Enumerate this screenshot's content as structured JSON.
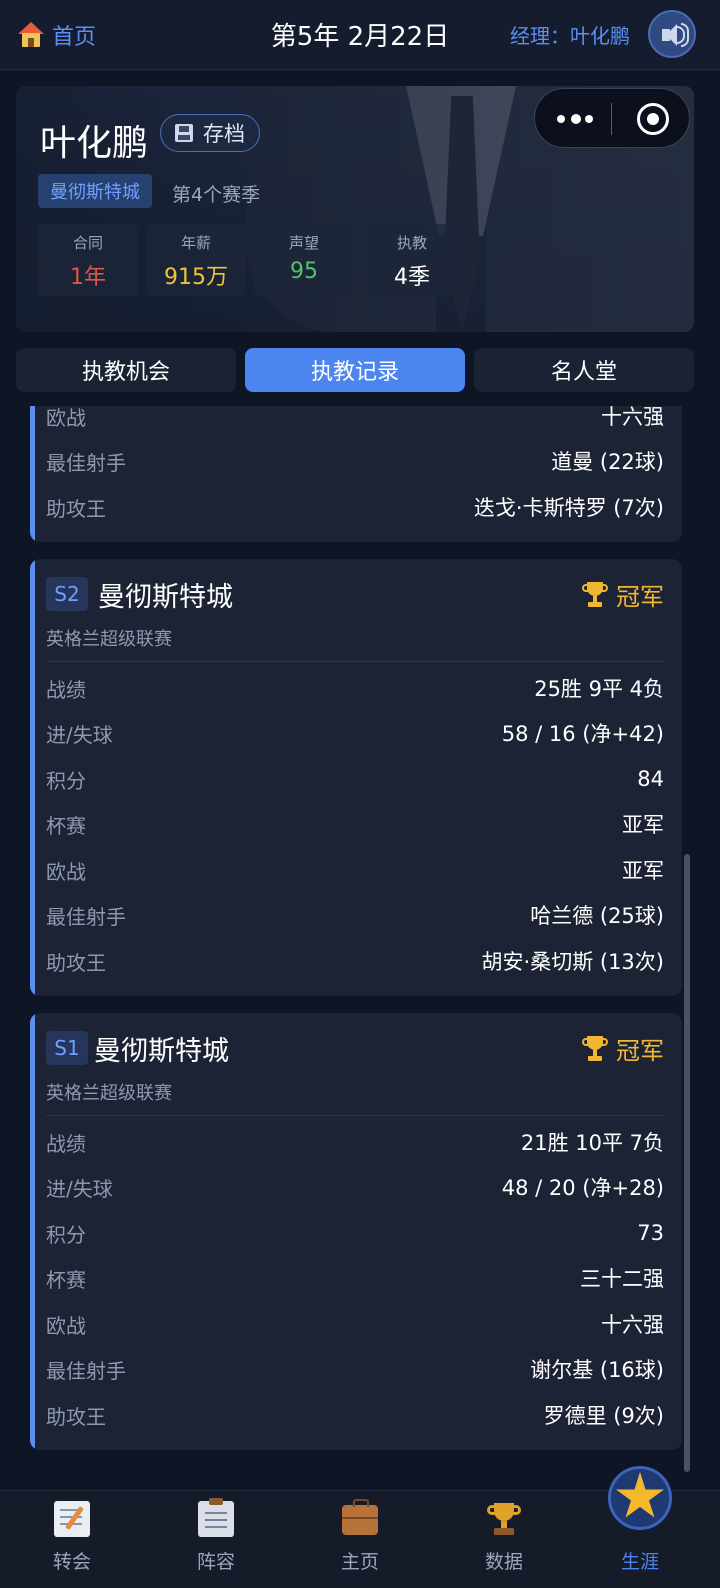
{
  "topbar": {
    "home_label": "首页",
    "date": "第5年 2月22日",
    "manager": "经理：叶化鹏"
  },
  "profile": {
    "name": "叶化鹏",
    "save_label": "存档",
    "club": "曼彻斯特城",
    "season": "第4个赛季",
    "stats": [
      {
        "label": "合同",
        "value": "1年",
        "color": "#e8524a"
      },
      {
        "label": "年薪",
        "value": "915万",
        "color": "#f1c23a"
      },
      {
        "label": "声望",
        "value": "95",
        "color": "#55c267"
      },
      {
        "label": "执教",
        "value": "4季",
        "color": "#ffffff"
      }
    ]
  },
  "tabs": [
    {
      "label": "执教机会",
      "active": false
    },
    {
      "label": "执教记录",
      "active": true
    },
    {
      "label": "名人堂",
      "active": false
    }
  ],
  "records": [
    {
      "partial": true,
      "rows": [
        {
          "k": "欧战",
          "v": "十六强"
        },
        {
          "k": "最佳射手",
          "v": "道曼 (22球)"
        },
        {
          "k": "助攻王",
          "v": "迭戈·卡斯特罗 (7次)"
        }
      ]
    },
    {
      "season": "S2",
      "club": "曼彻斯特城",
      "result": "冠军",
      "league": "英格兰超级联赛",
      "rows": [
        {
          "k": "战绩",
          "v": "25胜 9平 4负"
        },
        {
          "k": "进/失球",
          "v": "58 / 16 (净+42)"
        },
        {
          "k": "积分",
          "v": "84"
        },
        {
          "k": "杯赛",
          "v": "亚军"
        },
        {
          "k": "欧战",
          "v": "亚军"
        },
        {
          "k": "最佳射手",
          "v": "哈兰德 (25球)"
        },
        {
          "k": "助攻王",
          "v": "胡安·桑切斯 (13次)"
        }
      ]
    },
    {
      "season": "S1",
      "club": "曼彻斯特城",
      "result": "冠军",
      "league": "英格兰超级联赛",
      "rows": [
        {
          "k": "战绩",
          "v": "21胜 10平 7负"
        },
        {
          "k": "进/失球",
          "v": "48 / 20 (净+28)"
        },
        {
          "k": "积分",
          "v": "73"
        },
        {
          "k": "杯赛",
          "v": "三十二强"
        },
        {
          "k": "欧战",
          "v": "十六强"
        },
        {
          "k": "最佳射手",
          "v": "谢尔基 (16球)"
        },
        {
          "k": "助攻王",
          "v": "罗德里 (9次)"
        }
      ]
    }
  ],
  "bottom_nav": [
    {
      "label": "转会",
      "icon": "note-icon"
    },
    {
      "label": "阵容",
      "icon": "clipboard-icon"
    },
    {
      "label": "主页",
      "icon": "briefcase-icon"
    },
    {
      "label": "数据",
      "icon": "trophy-icon"
    },
    {
      "label": "生涯",
      "icon": "star-icon",
      "active": true
    }
  ]
}
